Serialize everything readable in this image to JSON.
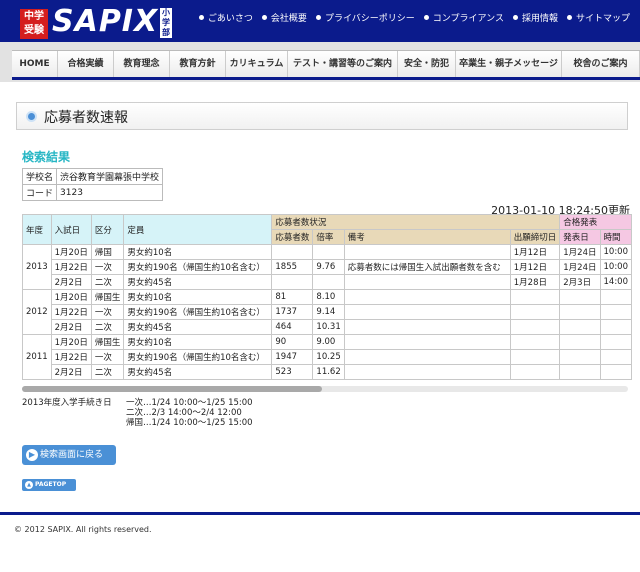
{
  "header": {
    "logo_badge": "中学受験",
    "logo_text": "SAPIX",
    "logo_side": "小学部",
    "links": [
      "ごあいさつ",
      "会社概要",
      "プライバシーポリシー",
      "コンプライアンス",
      "採用情報",
      "サイトマップ"
    ]
  },
  "nav": {
    "items": [
      "HOME",
      "合格実績",
      "教育理念",
      "教育方針",
      "カリキュラム",
      "テスト・講習等のご案内",
      "安全・防犯",
      "卒業生・親子メッセージ",
      "校舎のご案内"
    ]
  },
  "page": {
    "title": "応募者数速報",
    "result_title": "検索結果",
    "timestamp": "2013-01-10 18:24:50更新"
  },
  "school": {
    "name_label": "学校名",
    "name": "渋谷教育学園幕張中学校",
    "code_label": "コード",
    "code": "3123"
  },
  "table": {
    "headers": {
      "year": "年度",
      "exam_date": "入試日",
      "category": "区分",
      "capacity": "定員",
      "applicant_status": "応募者数状況",
      "applicants": "応募者数",
      "ratio": "倍率",
      "notes": "備考",
      "deadline": "出願締切日",
      "result_announce": "合格発表",
      "announce_date": "発表日",
      "announce_time": "時間"
    },
    "rows": [
      {
        "year": "",
        "date": "1月20日",
        "cat": "帰国",
        "cap": "男女約10名",
        "apps": "",
        "ratio": "",
        "notes": "",
        "deadline": "1月12日",
        "ann_date": "1月24日",
        "ann_time": "10:00"
      },
      {
        "year": "2013",
        "date": "1月22日",
        "cat": "一次",
        "cap": "男女約190名（帰国生約10名含む）",
        "apps": "1855",
        "ratio": "9.76",
        "notes": "応募者数には帰国生入試出願者数を含む",
        "deadline": "1月12日",
        "ann_date": "1月24日",
        "ann_time": "10:00"
      },
      {
        "year": "",
        "date": "2月2日",
        "cat": "二次",
        "cap": "男女約45名",
        "apps": "",
        "ratio": "",
        "notes": "",
        "deadline": "1月28日",
        "ann_date": "2月3日",
        "ann_time": "14:00"
      },
      {
        "year": "",
        "date": "1月20日",
        "cat": "帰国生",
        "cap": "男女約10名",
        "apps": "81",
        "ratio": "8.10",
        "notes": "",
        "deadline": "",
        "ann_date": "",
        "ann_time": ""
      },
      {
        "year": "2012",
        "date": "1月22日",
        "cat": "一次",
        "cap": "男女約190名（帰国生約10名含む）",
        "apps": "1737",
        "ratio": "9.14",
        "notes": "",
        "deadline": "",
        "ann_date": "",
        "ann_time": ""
      },
      {
        "year": "",
        "date": "2月2日",
        "cat": "二次",
        "cap": "男女約45名",
        "apps": "464",
        "ratio": "10.31",
        "notes": "",
        "deadline": "",
        "ann_date": "",
        "ann_time": ""
      },
      {
        "year": "",
        "date": "1月20日",
        "cat": "帰国生",
        "cap": "男女約10名",
        "apps": "90",
        "ratio": "9.00",
        "notes": "",
        "deadline": "",
        "ann_date": "",
        "ann_time": ""
      },
      {
        "year": "2011",
        "date": "1月22日",
        "cat": "一次",
        "cap": "男女約190名（帰国生約10名含む）",
        "apps": "1947",
        "ratio": "10.25",
        "notes": "",
        "deadline": "",
        "ann_date": "",
        "ann_time": ""
      },
      {
        "year": "",
        "date": "2月2日",
        "cat": "二次",
        "cap": "男女約45名",
        "apps": "523",
        "ratio": "11.62",
        "notes": "",
        "deadline": "",
        "ann_date": "",
        "ann_time": ""
      }
    ]
  },
  "schedule": {
    "label": "2013年度入学手続き日",
    "lines": [
      "一次…1/24 10:00～1/25 15:00",
      "二次…2/3 14:00～2/4 12:00",
      "帰国…1/24 10:00～1/25 15:00"
    ]
  },
  "buttons": {
    "back": "検索画面に戻る",
    "pagetop": "PAGETOP"
  },
  "footer": {
    "copyright": "© 2012 SAPIX. All rights reserved."
  },
  "colors": {
    "brand_navy": "#0b1b8c",
    "accent_red": "#d41e1e",
    "result_title": "#26b6c4",
    "button_blue": "#4a90d6"
  }
}
